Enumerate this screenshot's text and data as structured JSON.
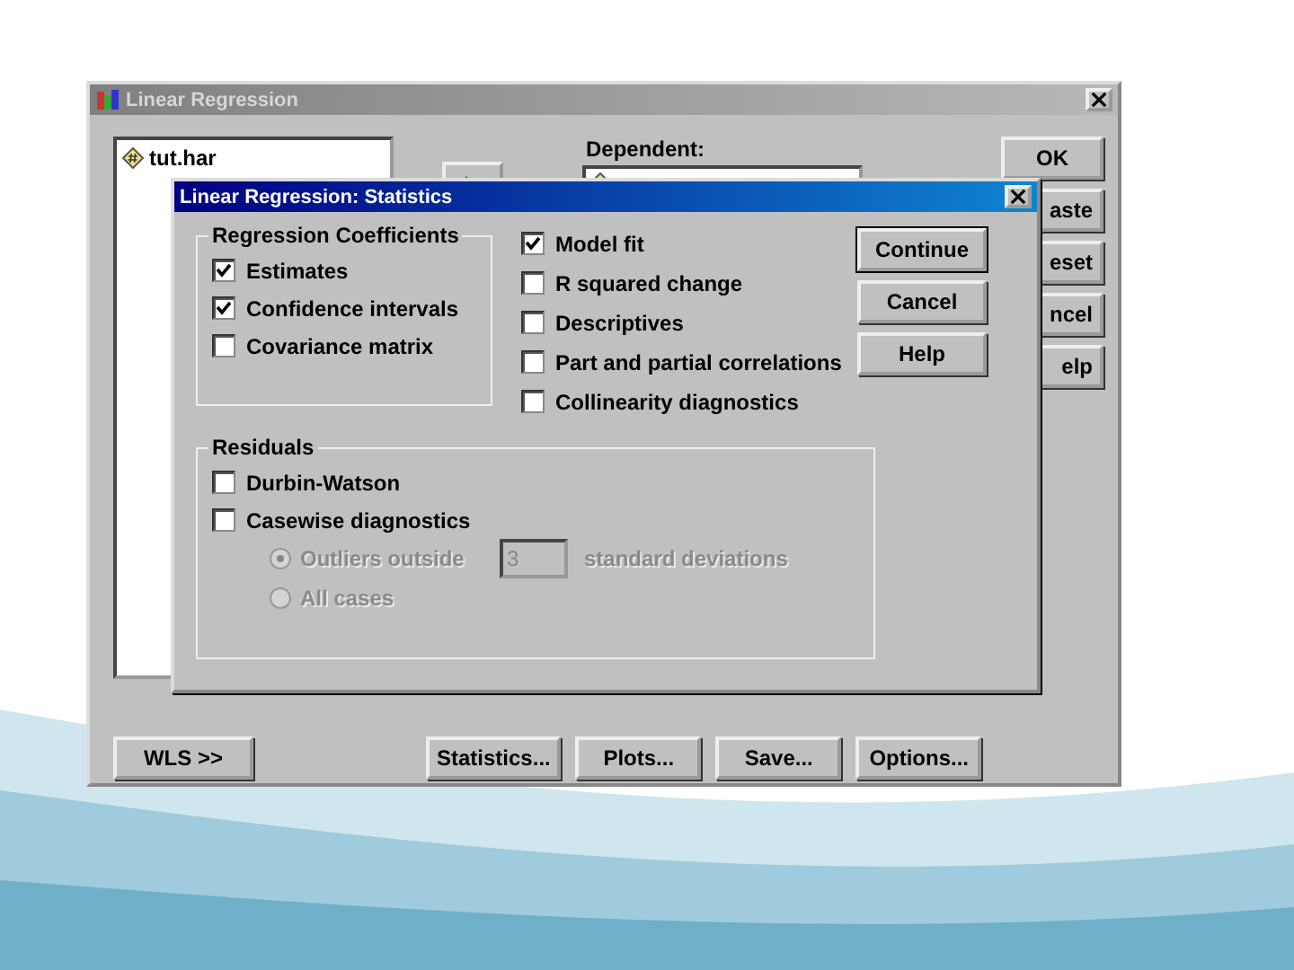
{
  "main_window": {
    "title": "Linear Regression",
    "variables": [
      {
        "name": "tut.har"
      }
    ],
    "dependent_label": "Dependent:",
    "buttons": [
      "OK",
      "aste",
      "eset",
      "ncel",
      "elp"
    ],
    "bottom_buttons": [
      "WLS >>",
      "Statistics...",
      "Plots...",
      "Save...",
      "Options..."
    ]
  },
  "dialog": {
    "title": "Linear Regression: Statistics",
    "coefficients": {
      "title": "Regression Coefficients",
      "options": [
        {
          "label": "Estimates",
          "checked": true
        },
        {
          "label": "Confidence intervals",
          "checked": true
        },
        {
          "label": "Covariance matrix",
          "checked": false
        }
      ]
    },
    "options": [
      {
        "label": "Model fit",
        "checked": true
      },
      {
        "label": "R squared change",
        "checked": false
      },
      {
        "label": "Descriptives",
        "checked": false
      },
      {
        "label": "Part and partial correlations",
        "checked": false
      },
      {
        "label": "Collinearity diagnostics",
        "checked": false
      }
    ],
    "buttons": [
      "Continue",
      "Cancel",
      "Help"
    ],
    "residuals": {
      "title": "Residuals",
      "options": [
        {
          "label": "Durbin-Watson",
          "checked": false
        },
        {
          "label": "Casewise diagnostics",
          "checked": false
        }
      ],
      "casewise": {
        "disabled": true,
        "choices": [
          {
            "label": "Outliers outside",
            "selected": true
          },
          {
            "label": "All cases",
            "selected": false
          }
        ],
        "outlier_value": "3",
        "unit": "standard deviations"
      }
    }
  }
}
